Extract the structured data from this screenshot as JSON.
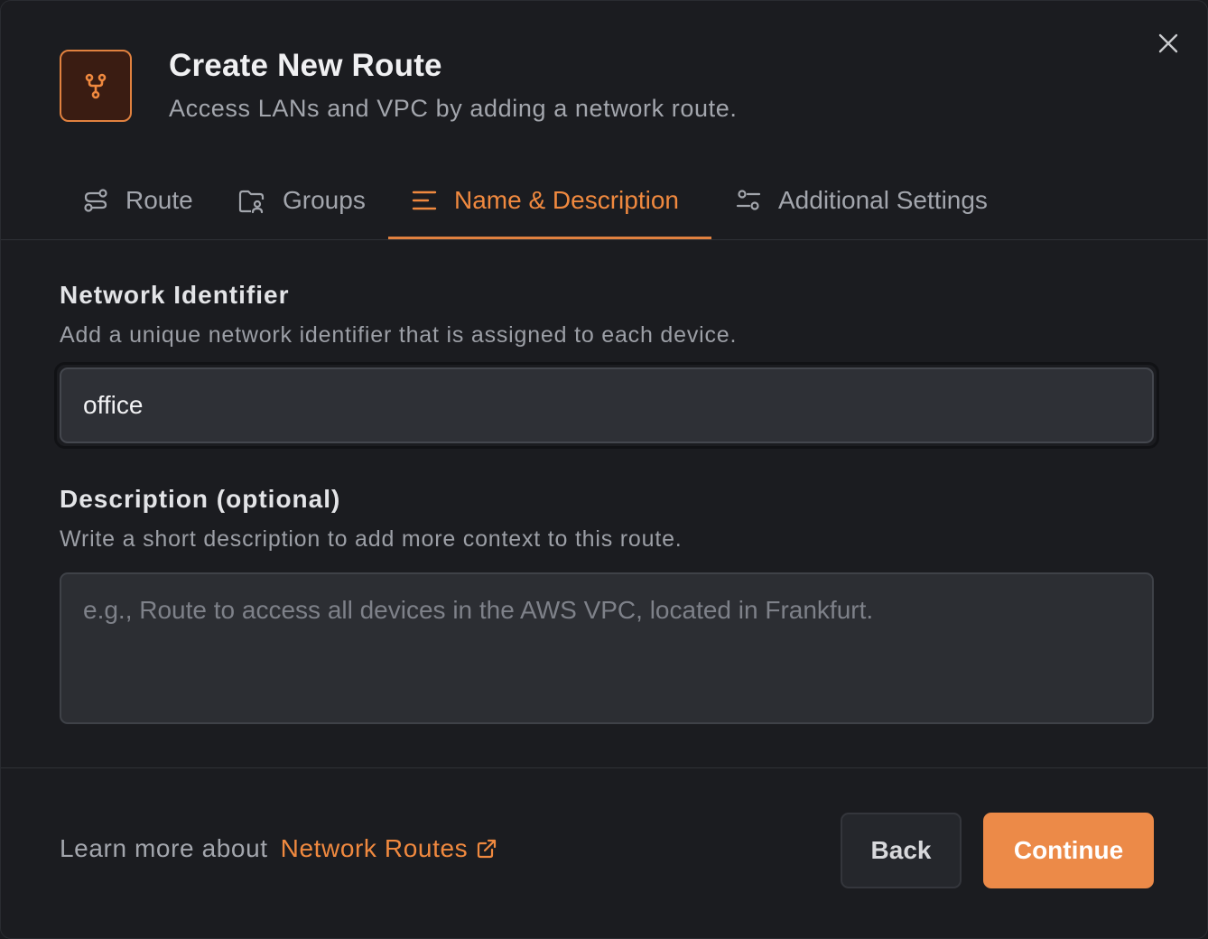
{
  "dialog": {
    "title": "Create New Route",
    "subtitle": "Access LANs and VPC by adding a network route.",
    "header_icon": "route-fork-icon",
    "close_icon": "close-icon"
  },
  "tabs": [
    {
      "label": "Route",
      "icon": "route-icon",
      "active": false
    },
    {
      "label": "Groups",
      "icon": "groups-icon",
      "active": false
    },
    {
      "label": "Name & Description",
      "icon": "text-align-icon",
      "active": true
    },
    {
      "label": "Additional Settings",
      "icon": "settings-sliders-icon",
      "active": false
    }
  ],
  "form": {
    "network_identifier": {
      "label": "Network Identifier",
      "help": "Add a unique network identifier that is assigned to each device.",
      "value": "office"
    },
    "description": {
      "label": "Description (optional)",
      "help": "Write a short description to add more context to this route.",
      "value": "",
      "placeholder": "e.g., Route to access all devices in the AWS VPC, located in Frankfurt."
    }
  },
  "footer": {
    "learn_prefix": "Learn more about",
    "learn_link": "Network Routes",
    "back_label": "Back",
    "continue_label": "Continue"
  },
  "colors": {
    "accent": "#ec8a48",
    "background": "#1b1c20",
    "input_background": "#2e3036"
  }
}
